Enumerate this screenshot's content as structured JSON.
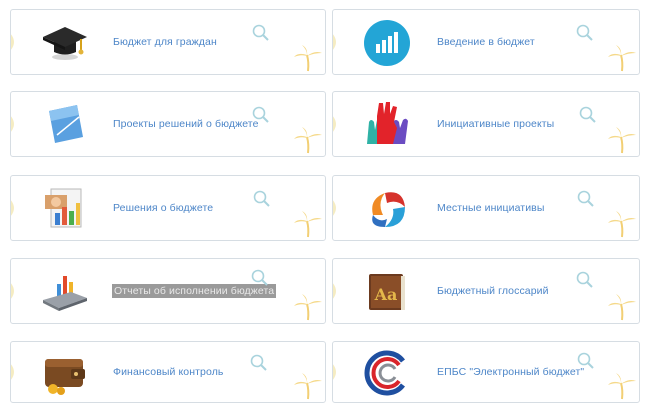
{
  "tiles": [
    {
      "label": "Бюджет для граждан",
      "icon": "graduation-cap-icon"
    },
    {
      "label": "Введение в бюджет",
      "icon": "bar-chart-icon"
    },
    {
      "label": "Проекты решений о бюджете",
      "icon": "document-icon"
    },
    {
      "label": "Инициативные проекты",
      "icon": "raised-hands-icon"
    },
    {
      "label": "Решения о бюджете",
      "icon": "chart-report-icon"
    },
    {
      "label": "Местные инициативы",
      "icon": "people-circle-icon"
    },
    {
      "label": "Отчеты об исполнении бюджета",
      "icon": "calculator-chart-icon",
      "selected": true
    },
    {
      "label": "Бюджетный глоссарий",
      "icon": "book-icon"
    },
    {
      "label": "Финансовый контроль",
      "icon": "wallet-icon"
    },
    {
      "label": "ЕПБС \"Электронный бюджет\"",
      "icon": "ebudget-logo-icon"
    }
  ],
  "colors": {
    "label": "#4d86c8",
    "border": "#d6dde3",
    "accent": "#f5d98a",
    "search": "#a9d3dd"
  }
}
